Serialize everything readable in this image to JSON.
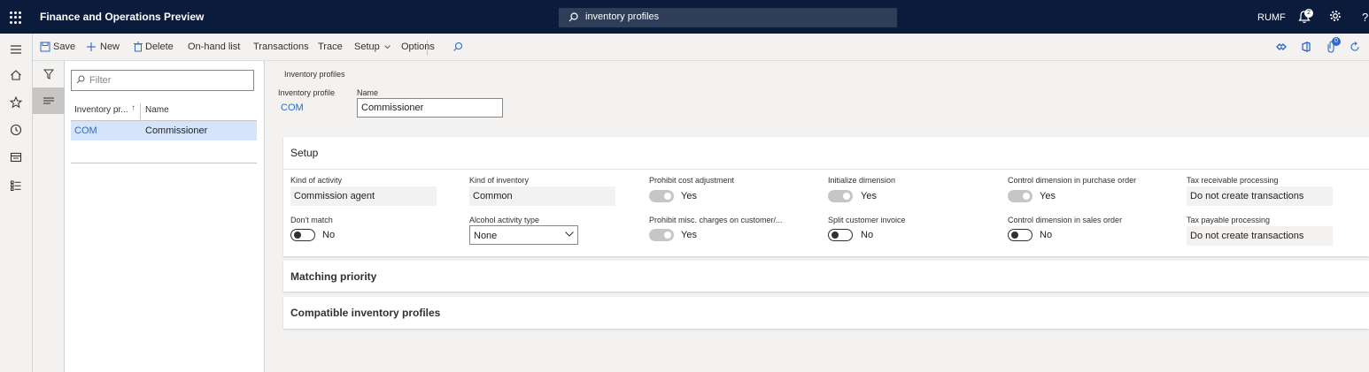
{
  "topbar": {
    "app_title": "Finance and Operations Preview",
    "search_text": "inventory profiles",
    "company": "RUMF",
    "notification_count": "2",
    "help_label": "?"
  },
  "actions": {
    "save": "Save",
    "new": "New",
    "delete": "Delete",
    "on_hand": "On-hand list",
    "transactions": "Transactions",
    "trace": "Trace",
    "setup": "Setup",
    "options": "Options",
    "attach_count": "0"
  },
  "list": {
    "filter_placeholder": "Filter",
    "col_profile": "Inventory pr...",
    "col_name": "Name",
    "row": {
      "profile": "COM",
      "name": "Commissioner"
    }
  },
  "details": {
    "caption": "Inventory profiles",
    "profile_label": "Inventory profile",
    "profile_value": "COM",
    "name_label": "Name",
    "name_value": "Commissioner"
  },
  "setup": {
    "title": "Setup",
    "kind_of_activity_label": "Kind of activity",
    "kind_of_activity_value": "Commission agent",
    "kind_of_inventory_label": "Kind of inventory",
    "kind_of_inventory_value": "Common",
    "prohibit_cost_label": "Prohibit cost adjustment",
    "prohibit_cost_value": "Yes",
    "init_dim_label": "Initialize dimension",
    "init_dim_value": "Yes",
    "ctrl_dim_po_label": "Control dimension in purchase order",
    "ctrl_dim_po_value": "Yes",
    "tax_recv_label": "Tax receivable processing",
    "tax_recv_value": "Do not create transactions",
    "dont_match_label": "Don't match",
    "dont_match_value": "No",
    "alcohol_label": "Alcohol activity type",
    "alcohol_value": "None",
    "prohibit_misc_label": "Prohibit misc. charges on customer/...",
    "prohibit_misc_value": "Yes",
    "split_inv_label": "Split customer invoice",
    "split_inv_value": "No",
    "ctrl_dim_so_label": "Control dimension in sales order",
    "ctrl_dim_so_value": "No",
    "tax_pay_label": "Tax payable processing",
    "tax_pay_value": "Do not create transactions"
  },
  "matching": {
    "title": "Matching priority"
  },
  "compatible": {
    "title": "Compatible inventory profiles"
  }
}
